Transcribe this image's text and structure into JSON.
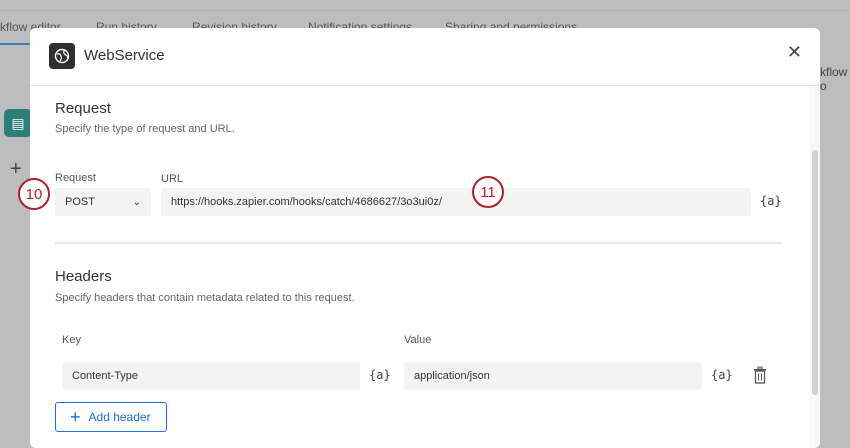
{
  "background": {
    "tabs": [
      "kflow editor",
      "Run history",
      "Revision history",
      "Notification settings",
      "Sharing and permissions"
    ],
    "right_text": "kflow o"
  },
  "modal": {
    "title": "WebService",
    "request": {
      "heading": "Request",
      "description": "Specify the type of request and URL.",
      "method_label": "Request",
      "method": "POST",
      "url_label": "URL",
      "url": "https://hooks.zapier.com/hooks/catch/4686627/3o3ui0z/",
      "var_token": "{a}"
    },
    "headers": {
      "heading": "Headers",
      "description": "Specify headers that contain metadata related to this request.",
      "key_label": "Key",
      "value_label": "Value",
      "rows": [
        {
          "key": "Content-Type",
          "value": "application/json"
        }
      ],
      "var_token": "{a}",
      "add_label": "Add header"
    }
  },
  "annotations": [
    "10",
    "11"
  ]
}
